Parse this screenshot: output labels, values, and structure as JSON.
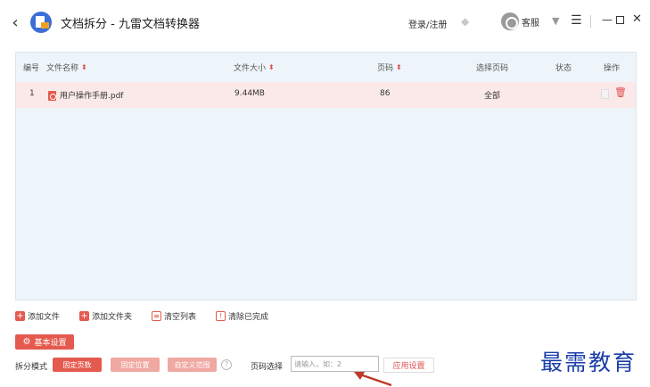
{
  "window": {
    "title": "文档拆分 - 九雷文档转换器",
    "login_label": "登录/注册",
    "service_label": "客服",
    "icons": {
      "vip": "diamond-icon",
      "skin": "tshirt-icon",
      "menu": "menu-icon",
      "min": "minimize-icon",
      "max": "maximize-icon",
      "close": "close-icon"
    }
  },
  "table": {
    "headers": {
      "index": "编号",
      "name": "文件名称",
      "size": "文件大小",
      "pages": "页码",
      "select_pages": "选择页码",
      "status": "状态",
      "actions": "操作"
    },
    "rows": [
      {
        "index": "1",
        "name": "用户操作手册.pdf",
        "size": "9.44MB",
        "pages": "86",
        "select_pages": "全部",
        "status": ""
      }
    ]
  },
  "toolbar": {
    "add_file": "添加文件",
    "add_folder": "添加文件夹",
    "clear_list": "清空列表",
    "clear_done": "清除已完成"
  },
  "settings": {
    "basic_label": "基本设置",
    "split_mode_label": "拆分模式",
    "modes": [
      "固定页数",
      "固定位置",
      "自定义范围"
    ],
    "active_mode": "固定页数",
    "page_select_label": "页码选择",
    "page_input_placeholder": "请输入，如：2",
    "apply_label": "应用设置"
  },
  "watermark": "最需教育",
  "colors": {
    "accent": "#e55a4e",
    "row_highlight": "#fbe9e9",
    "table_bg": "#eef5fa",
    "watermark": "#1a3ea8"
  }
}
